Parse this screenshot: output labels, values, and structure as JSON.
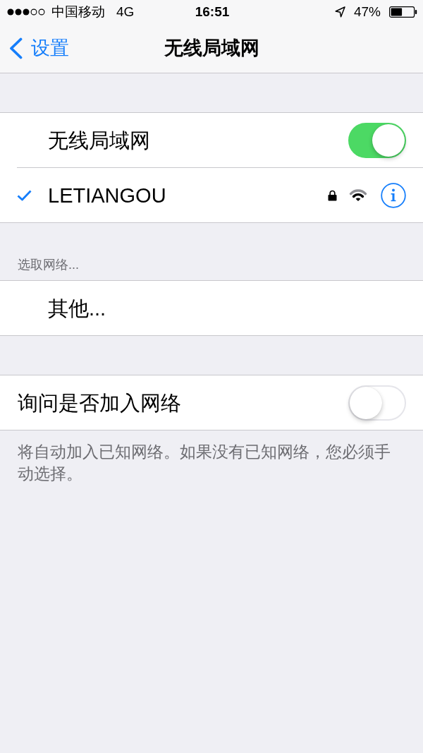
{
  "status_bar": {
    "carrier": "中国移动",
    "network": "4G",
    "time": "16:51",
    "battery": "47%"
  },
  "nav_bar": {
    "back": "设置",
    "title": "无线局域网"
  },
  "sections": [
    {
      "kind": "network_list",
      "rows": [
        {
          "kind": "toggle",
          "label": "无线局域网",
          "on": true
        },
        {
          "kind": "network",
          "label": "LETIANGOU",
          "selected": true,
          "locked": true
        }
      ]
    },
    {
      "kind": "network_list",
      "header": "选取网络...",
      "rows": [
        {
          "kind": "link",
          "label": "其他..."
        }
      ]
    },
    {
      "kind": "settings",
      "rows": [
        {
          "kind": "toggle",
          "label": "询问是否加入网络",
          "on": false
        }
      ],
      "footer": "将自动加入已知网络。如果没有已知网络，您必须手动选择。"
    }
  ]
}
